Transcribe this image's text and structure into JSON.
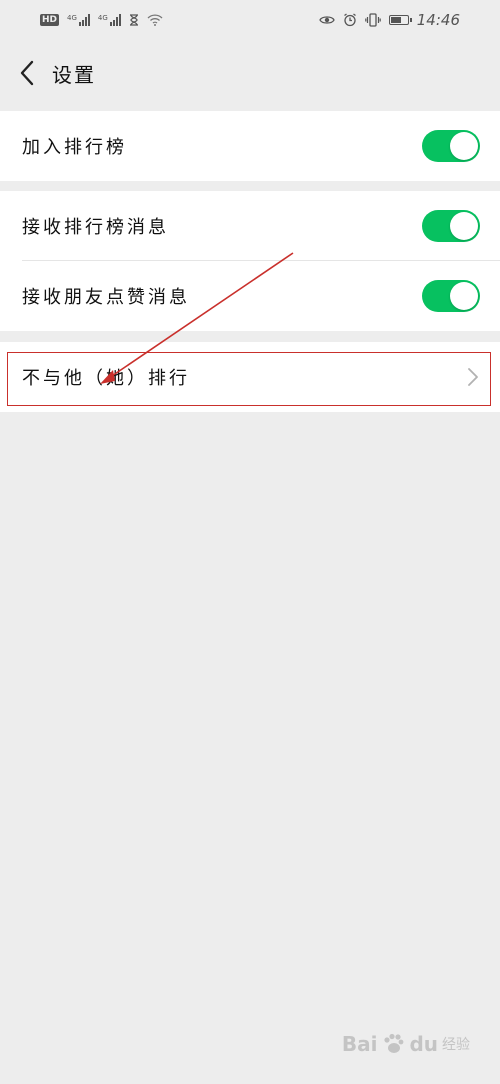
{
  "status_bar": {
    "hd_label": "HD",
    "net1": "4G",
    "net2": "4G",
    "time": "14:46",
    "battery_level": 0.7
  },
  "nav": {
    "title": "设置"
  },
  "settings": {
    "join_leaderboard": {
      "label": "加入排行榜",
      "enabled": true
    },
    "receive_leaderboard_msg": {
      "label": "接收排行榜消息",
      "enabled": true
    },
    "receive_like_msg": {
      "label": "接收朋友点赞消息",
      "enabled": true
    },
    "exclude_ranking": {
      "label": "不与他（她）排行"
    }
  },
  "watermark": {
    "brand": "Bai",
    "brand_suffix": "du",
    "sub": "经验"
  },
  "colors": {
    "toggle_on": "#07c160",
    "annotation_red": "#c9302c",
    "background": "#ededed"
  }
}
